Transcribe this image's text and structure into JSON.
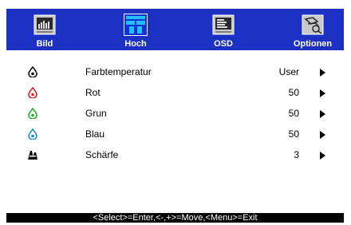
{
  "tabs": [
    {
      "label": "Bild",
      "icon": "picture-icon"
    },
    {
      "label": "Hoch",
      "icon": "advanced-icon"
    },
    {
      "label": "OSD",
      "icon": "osd-icon"
    },
    {
      "label": "Optionen",
      "icon": "options-icon"
    }
  ],
  "selected_tab": "Hoch",
  "rows": [
    {
      "label": "Farbtemperatur",
      "value": "User",
      "icon": "color-temperature-icon",
      "icon_color": "#000000"
    },
    {
      "label": "Rot",
      "value": "50",
      "icon": "red-drop-icon",
      "icon_color": "#e01818"
    },
    {
      "label": "Grun",
      "value": "50",
      "icon": "green-drop-icon",
      "icon_color": "#18b418"
    },
    {
      "label": "Blau",
      "value": "50",
      "icon": "blue-drop-icon",
      "icon_color": "#1890d0"
    },
    {
      "label": "Schärfe",
      "value": "3",
      "icon": "sharpness-icon",
      "icon_color": "#000000"
    }
  ],
  "status_bar": "<Select>=Enter,<-,+>=Move,<Menu>=Exit",
  "colors": {
    "menu_bar": "#1c31c4",
    "background": "#ffffff"
  }
}
